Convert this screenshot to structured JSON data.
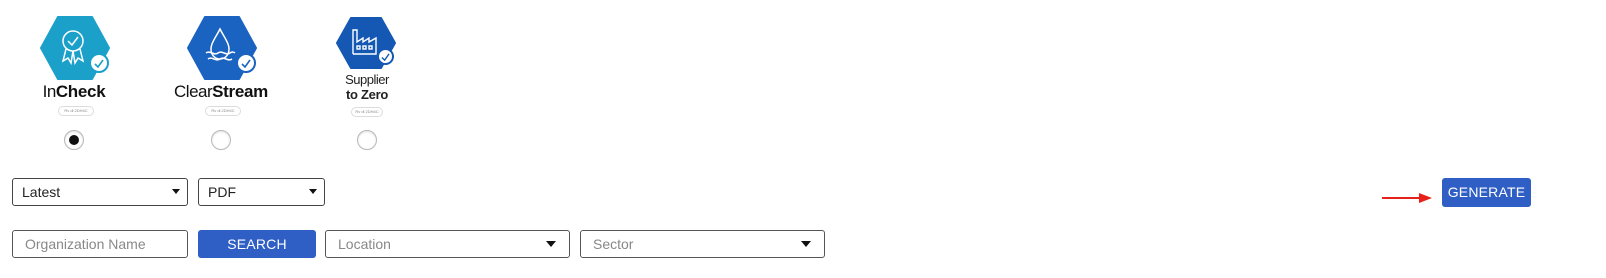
{
  "programs": [
    {
      "name_part1": "In",
      "name_part2": "Check",
      "level_pill": "Rv dl 2DH4C",
      "hex_color": "#1aa0c9",
      "icon": "award-ribbon-icon",
      "selected": true
    },
    {
      "name_part1": "Clear",
      "name_part2": "Stream",
      "level_pill": "Rv dl 2DH4C",
      "hex_color": "#1a63c0",
      "icon": "water-drop-icon",
      "selected": false
    },
    {
      "name_line1": "Supplier",
      "name_line2": "to Zero",
      "level_pill": "Rv dl 2DH4C",
      "hex_color": "#1458b4",
      "icon": "factory-icon",
      "selected": false
    }
  ],
  "filters": {
    "version_select": "Latest",
    "format_select": "PDF"
  },
  "actions": {
    "generate_label": "GENERATE",
    "search_label": "SEARCH"
  },
  "search": {
    "organization_placeholder": "Organization Name",
    "location_placeholder": "Location",
    "sector_placeholder": "Sector"
  },
  "colors": {
    "button_blue": "#2f5ec4",
    "arrow_red": "#e8201a"
  }
}
